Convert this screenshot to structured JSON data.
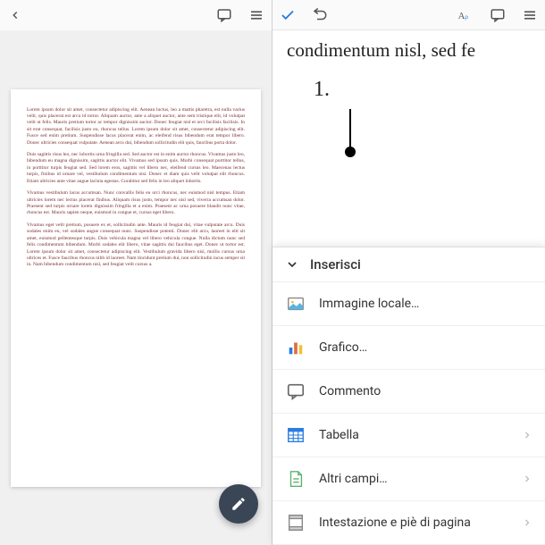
{
  "left_toolbar": {
    "back": "back-chevron",
    "comment": "comment",
    "more": "more"
  },
  "right_toolbar": {
    "done": "done",
    "undo": "undo",
    "text_style": "text-style",
    "comment": "comment",
    "more": "more"
  },
  "document": {
    "paragraphs": [
      "Lorem ipsum dolor sit amet, consectetur adipiscing elit. Aenean luctus, leo a mattis pharetra, est nulla varius velit, quis placerat est arcu id tortor. Aliquam auctor, ante a aliquet auctor, ante sem tristique elit, id volutpat velit ut felis. Mauris pretium tortor ac tempor dignissim auctor. Donec feugiat nisl et orci facilisis facilisis. In sit erat consequat, facilisis justo eu, rhoncus tellus. Lorem ipsum dolor sit amet, consectetur adipiscing elit. Fusce sed enim pretium. Suspendisse lacus placerat enim, ac eleifend risus bibendum erat tempor libero. Donec ultricies consequat vulputate. Aenean arcu dui, bibendum sollicitudin elit quis, faucibus porta dolor.",
      "Duis sagittis risus leo, nec lobortis urna fringilla sed. Sed auctor est in enim auctor rhoncus. Vivamus justo leo, bibendum eu magna dignissim, sagittis auctor elit. Vivamus sed ipsum quis. Morbi consequat porttitor tellus, in porttitor turpis feugiat sed. Sed lorem eros, sagittis vel libero nec, eleifend cursus leo. Maecenas lectus turpis, finibus id ornare vel, vestibulum condimentum nisi. Donec et diam quis velit volutpat elit rhoncus. Etiam ultricies ante vitae augue lacinia egestas. Curabitur sed felis in leo aliquet lobortis.",
      "Vivamus vestibulum lacus accumsan. Nunc convallis felis eu orci rhoncus, nec euismod nisl tempus. Etiam ultricies lorem nec lectus placerat finibus. Aliquam risus justo, tempor nec nisl sed, viverra accumsan dolor. Praesent sed turpis ornare lorem dignissim fringilla et a enim. Praesent ac urna posuere blandit nunc vitae, rhoncus est. Mauris sapien neque, euismod in congue et, cursus eget libero.",
      "Vivamus eget velit pretium, posuere ex et, sollicitudin ante. Mauris id feugiat dui, vitae vulputate arcu. Duis sodales enim eu, vel sodales augue consequat nunc. Suspendisse potenti. Donec elit arcu, laoreet in elit sit amet, euismod pellentesque turpis. Duis vehicula magna vel libero vehicula congue. Nulla dictum nunc sed felis condimentum bibendum. Morbi sodales elit libero, vitae sagittis dui faucibus eget. Donec ut tortor est. Lorem ipsum dolor sit amet, consectetur adipiscing elit. Vestibulum gravida libero nisi, mollis cursus urna ultrices et. Fusce faucibus rhoncus nibh id laoreet. Nam tincidunt pretium dui, non sollicitudin lacus semper sit in. Nam bibendum condimentum nisl, sed feugiat velit cursus a."
    ]
  },
  "right_content": {
    "visible_text": "condimentum nisl, sed fe",
    "list_number": "1."
  },
  "insert_menu": {
    "title": "Inserisci",
    "items": [
      {
        "label": "Immagine locale…",
        "icon": "image",
        "chevron": false
      },
      {
        "label": "Grafico…",
        "icon": "chart",
        "chevron": false
      },
      {
        "label": "Commento",
        "icon": "comment",
        "chevron": false
      },
      {
        "label": "Tabella",
        "icon": "table",
        "chevron": true
      },
      {
        "label": "Altri campi…",
        "icon": "page",
        "chevron": true
      },
      {
        "label": "Intestazione e piè di pagina",
        "icon": "header-footer",
        "chevron": true
      }
    ]
  }
}
